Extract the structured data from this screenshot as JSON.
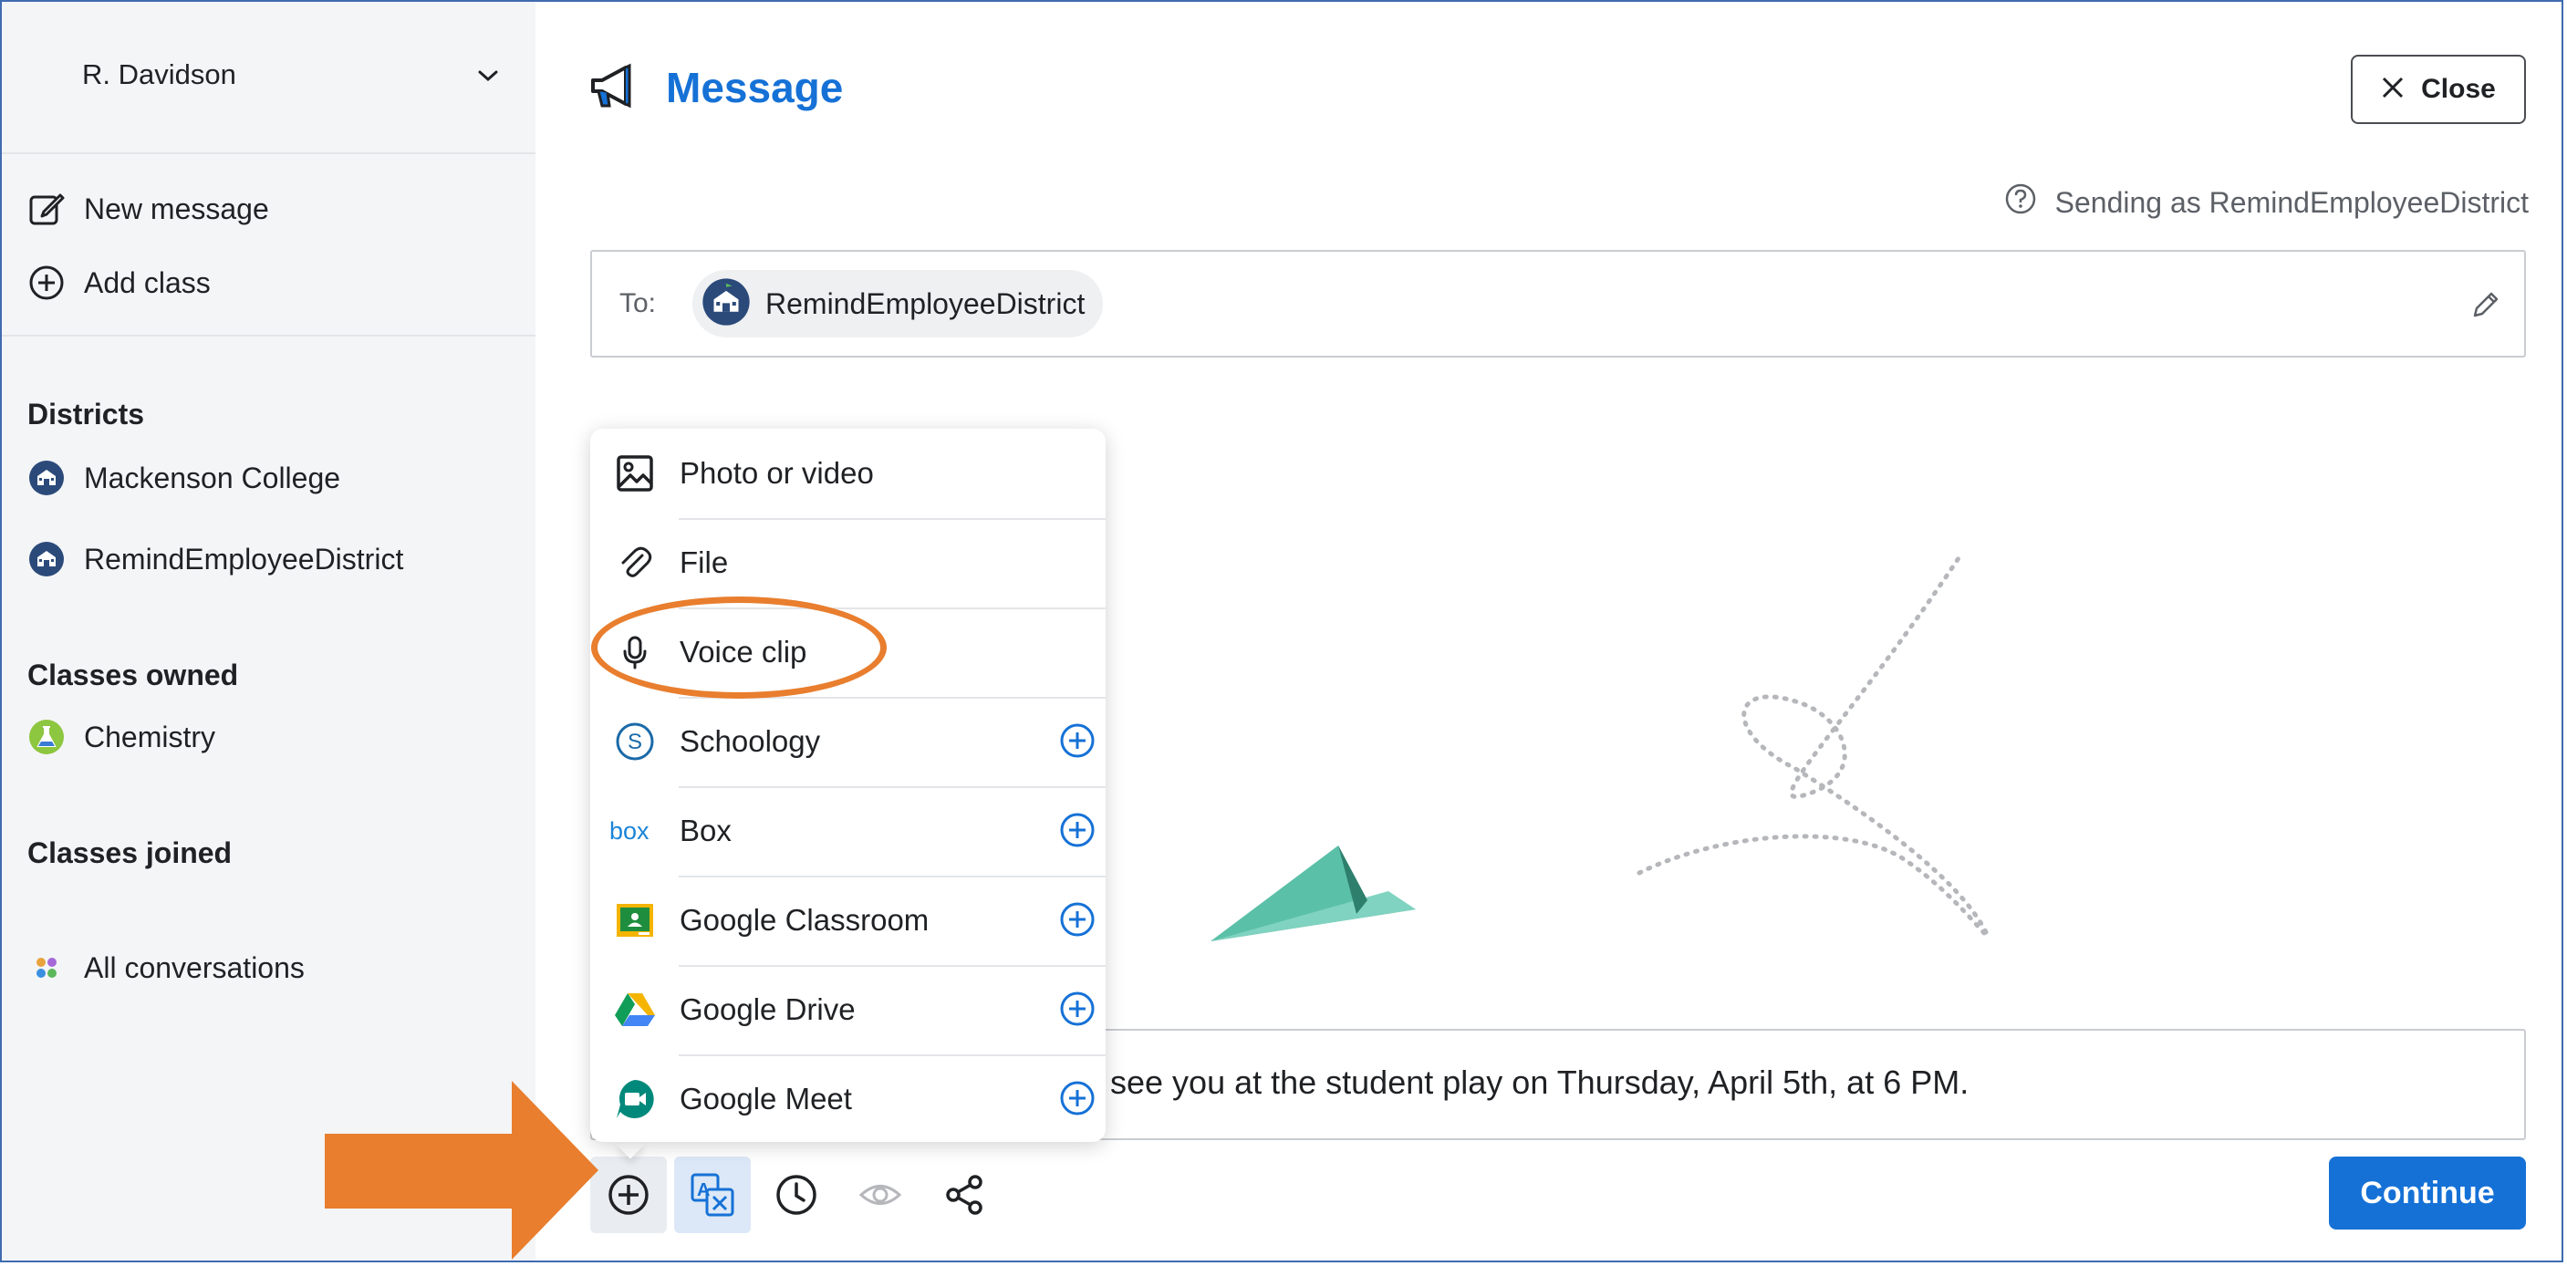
{
  "sidebar": {
    "user_name": "R. Davidson",
    "actions": [
      {
        "label": "New message",
        "icon": "compose-icon"
      },
      {
        "label": "Add class",
        "icon": "plus-circle-icon"
      }
    ],
    "districts_heading": "Districts",
    "districts": [
      {
        "label": "Mackenson College"
      },
      {
        "label": "RemindEmployeeDistrict"
      }
    ],
    "classes_owned_heading": "Classes owned",
    "classes_owned": [
      {
        "label": "Chemistry"
      }
    ],
    "classes_joined_heading": "Classes joined",
    "all_conversations": "All conversations"
  },
  "header": {
    "title": "Message",
    "close_label": "Close",
    "sending_as": "Sending as RemindEmployeeDistrict"
  },
  "recipient": {
    "to_label": "To:",
    "name": "RemindEmployeeDistrict"
  },
  "attach_menu": {
    "items": [
      {
        "label": "Photo or video",
        "icon": "image-icon",
        "has_add": false
      },
      {
        "label": "File",
        "icon": "paperclip-icon",
        "has_add": false
      },
      {
        "label": "Voice clip",
        "icon": "microphone-icon",
        "has_add": false
      },
      {
        "label": "Schoology",
        "icon": "schoology-icon",
        "has_add": true
      },
      {
        "label": "Box",
        "icon": "box-icon",
        "has_add": true
      },
      {
        "label": "Google Classroom",
        "icon": "google-classroom-icon",
        "has_add": true
      },
      {
        "label": "Google Drive",
        "icon": "google-drive-icon",
        "has_add": true
      },
      {
        "label": "Google Meet",
        "icon": "google-meet-icon",
        "has_add": true
      }
    ]
  },
  "composer": {
    "text": "see you at the student play on Thursday, April 5th, at 6 PM."
  },
  "toolbar": {
    "continue_label": "Continue",
    "buttons": [
      "attach-plus-icon",
      "translate-icon",
      "clock-icon",
      "eye-icon",
      "share-icon"
    ]
  },
  "colors": {
    "brand_blue": "#1571d6",
    "annotation_orange": "#e87e2e",
    "sidebar_bg": "#f4f5f7"
  }
}
